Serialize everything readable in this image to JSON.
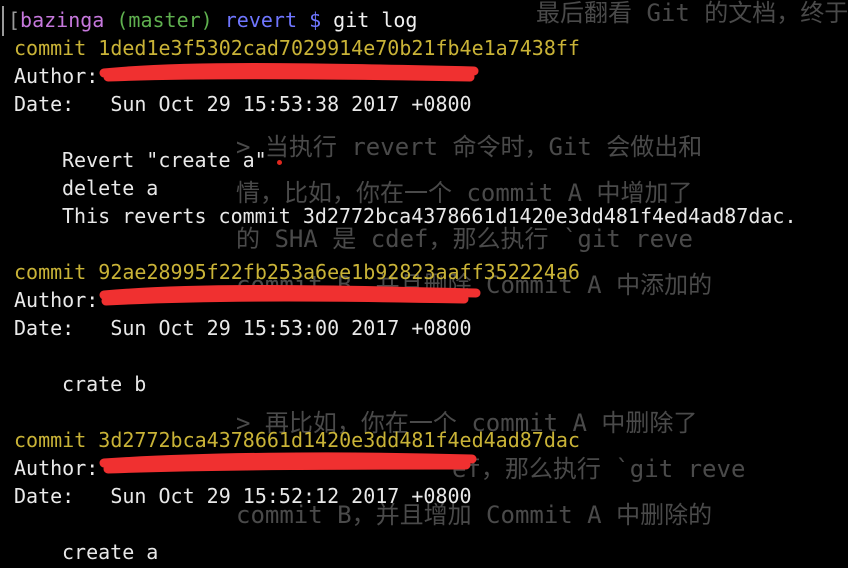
{
  "colors": {
    "background": "#000000",
    "commit_hash": "#c9b337",
    "prompt_user": "#c678dd",
    "prompt_branch": "#5fb04f",
    "prompt_dir": "#6f76ff",
    "redaction": "#f03030"
  },
  "prompt": {
    "bracket": "[",
    "user": "bazinga",
    "branch": "(master)",
    "dir": "revert",
    "symbol": "$",
    "command": "git log"
  },
  "commits": [
    {
      "label": "commit",
      "hash": "1ded1e3f5302cad7029914e70b21fb4e1a7438ff",
      "author_label": "Author:",
      "date_label": "Date:",
      "date": "Sun Oct 29 15:53:38 2017 +0800",
      "message": [
        "Revert \"create a\"",
        "delete a",
        "This reverts commit 3d2772bca4378661d1420e3dd481f4ed4ad87dac."
      ]
    },
    {
      "label": "commit",
      "hash": "92ae28995f22fb253a6ee1b92823aaff352224a6",
      "author_label": "Author:",
      "date_label": "Date:",
      "date": "Sun Oct 29 15:53:00 2017 +0800",
      "message": [
        "crate b"
      ]
    },
    {
      "label": "commit",
      "hash": "3d2772bca4378661d1420e3dd481f4ed4ad87dac",
      "author_label": "Author:",
      "date_label": "Date:",
      "date": "Sun Oct 29 15:52:12 2017 +0800",
      "message": [
        "create a"
      ]
    }
  ],
  "background_text": [
    "最后翻看 Git 的文档，终于搞",
    "> 当执行 revert 命令时，Git 会做出和",
    "情，比如，你在一个 commit A 中增加了",
    "的 SHA 是 cdef，那么执行 `git reve",
    "commit B，并且删除 Commit A 中添加的",
    "> 再比如，你在一个 commit A 中删除了",
    "ef，那么执行 `git reve",
    "commit B，并且增加 Commit A 中删除的"
  ]
}
